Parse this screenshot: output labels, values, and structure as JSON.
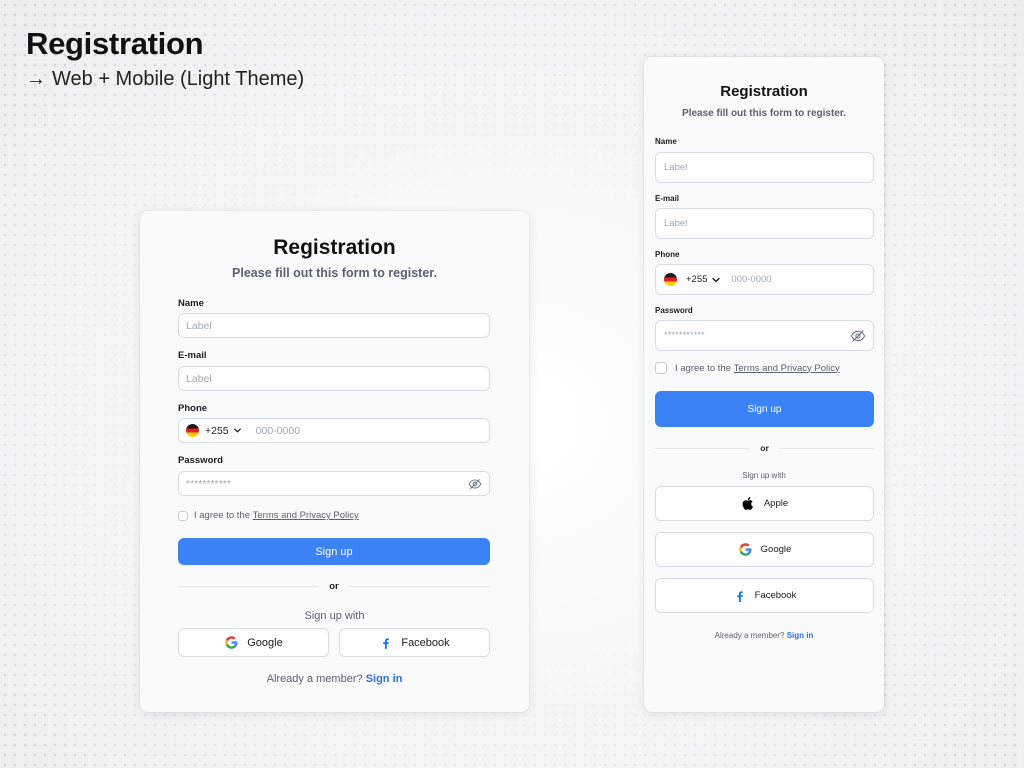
{
  "page": {
    "title": "Registration",
    "subtitle_arrow": "→",
    "subtitle": "Web + Mobile (Light Theme)"
  },
  "form": {
    "title": "Registration",
    "subtitle": "Please fill out this form to register.",
    "name_label": "Name",
    "name_placeholder": "Label",
    "email_label": "E-mail",
    "email_placeholder": "Label",
    "phone_label": "Phone",
    "phone_country_code": "+255",
    "phone_placeholder": "000-0000",
    "password_label": "Password",
    "password_value": "***********",
    "agree_prefix": "I agree to the",
    "agree_link": "Terms and Privacy Policy",
    "submit_label": "Sign up",
    "divider_text": "or",
    "signup_with": "Sign up with",
    "social": {
      "apple": "Apple",
      "google": "Google",
      "facebook": "Facebook"
    },
    "footer_prefix": "Already a member?",
    "footer_link": "Sign in"
  },
  "colors": {
    "primary": "#3b82f6",
    "link": "#2f6fd6",
    "facebook": "#1877f2"
  },
  "icons": {
    "flag": "germany-flag-icon",
    "chevron": "chevron-down-icon",
    "password_toggle": "eye-off-icon",
    "apple": "apple-icon",
    "google": "google-icon",
    "facebook": "facebook-icon"
  }
}
